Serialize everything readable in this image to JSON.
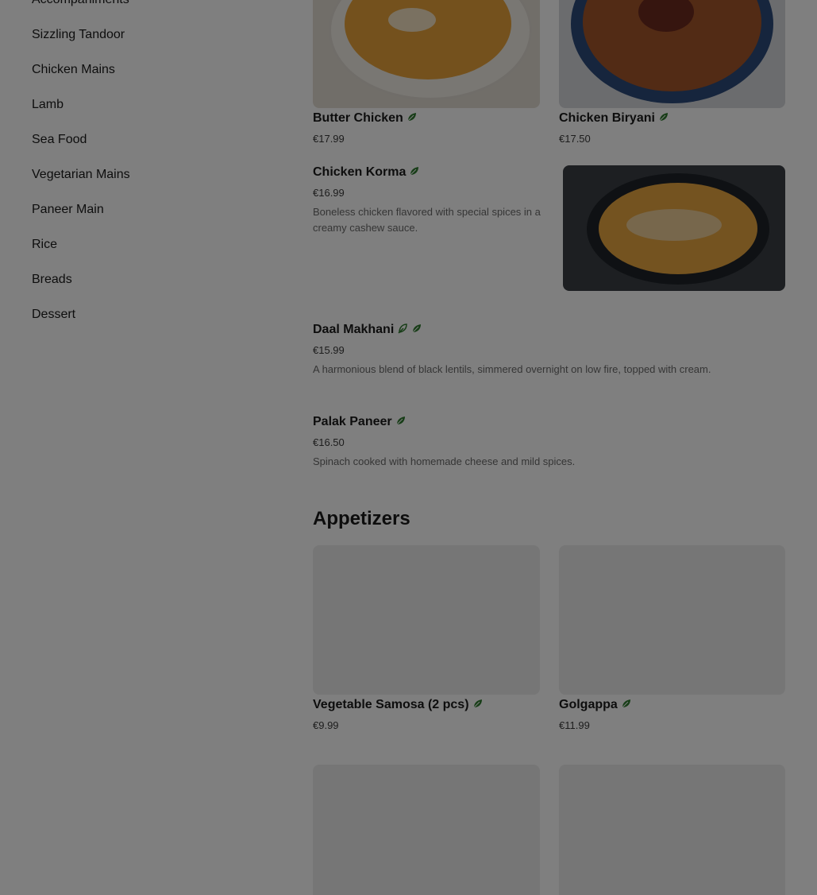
{
  "sidebar": {
    "items": [
      {
        "label": "Accompaniments"
      },
      {
        "label": "Sizzling Tandoor"
      },
      {
        "label": "Chicken Mains"
      },
      {
        "label": "Lamb"
      },
      {
        "label": "Sea Food"
      },
      {
        "label": "Vegetarian Mains"
      },
      {
        "label": "Paneer Main"
      },
      {
        "label": "Rice"
      },
      {
        "label": "Breads"
      },
      {
        "label": "Dessert"
      }
    ]
  },
  "dishes": {
    "butter_chicken": {
      "name": "Butter Chicken",
      "price": "€17.99",
      "icon": "leaf-icon"
    },
    "chicken_biryani": {
      "name": "Chicken Biryani",
      "price": "€17.50",
      "icon": "leaf-icon"
    },
    "chicken_korma": {
      "name": "Chicken Korma",
      "price": "€16.99",
      "desc": "Boneless chicken flavored with special spices in a creamy cashew sauce.",
      "icon": "leaf-icon"
    },
    "daal_makhani": {
      "name": "Daal Makhani",
      "price": "€15.99",
      "desc": "A harmonious blend of black lentils, simmered overnight on low fire, topped with cream.",
      "icons": [
        "vegan-leaf-icon",
        "leaf-icon"
      ]
    },
    "palak_paneer": {
      "name": "Palak Paneer",
      "price": "€16.50",
      "desc": "Spinach cooked with homemade cheese and mild spices.",
      "icon": "leaf-icon"
    }
  },
  "appetizers": {
    "title": "Appetizers",
    "items": [
      {
        "name": "Vegetable Samosa (2 pcs)",
        "price": "€9.99",
        "icon": "leaf-icon"
      },
      {
        "name": "Golgappa",
        "price": "€11.99",
        "icon": "leaf-icon"
      }
    ]
  },
  "colors": {
    "overlay": "#000000",
    "leaf": "#2f7a2f"
  }
}
